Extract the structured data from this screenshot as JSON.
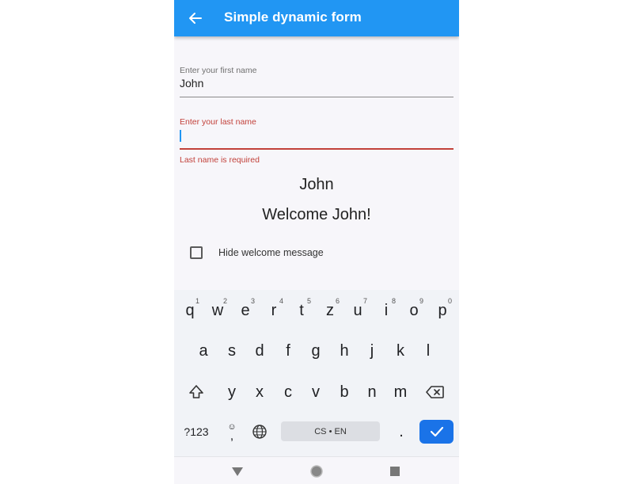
{
  "appbar": {
    "title": "Simple dynamic form",
    "back_icon": "arrow-left-icon",
    "color": "#2196f3"
  },
  "form": {
    "first_name": {
      "label": "Enter your first name",
      "value": "John"
    },
    "last_name": {
      "label": "Enter your last name",
      "value": "",
      "error": "Last name is required"
    },
    "name_display": "John",
    "welcome_message": "Welcome John!",
    "hide_checkbox": {
      "label": "Hide welcome message",
      "checked": false
    }
  },
  "keyboard": {
    "row1": [
      {
        "key": "q",
        "hint": "1"
      },
      {
        "key": "w",
        "hint": "2"
      },
      {
        "key": "e",
        "hint": "3"
      },
      {
        "key": "r",
        "hint": "4"
      },
      {
        "key": "t",
        "hint": "5"
      },
      {
        "key": "z",
        "hint": "6"
      },
      {
        "key": "u",
        "hint": "7"
      },
      {
        "key": "i",
        "hint": "8"
      },
      {
        "key": "o",
        "hint": "9"
      },
      {
        "key": "p",
        "hint": "0"
      }
    ],
    "row2": [
      "a",
      "s",
      "d",
      "f",
      "g",
      "h",
      "j",
      "k",
      "l"
    ],
    "row3": [
      "y",
      "x",
      "c",
      "v",
      "b",
      "n",
      "m"
    ],
    "symbols_label": "?123",
    "comma_label": ",",
    "period_label": ".",
    "space_label": "CS • EN",
    "enter_color": "#1a73e8"
  },
  "navbar": {
    "back_icon": "triangle-back-icon",
    "home_icon": "circle-home-icon",
    "recents_icon": "square-recents-icon"
  }
}
